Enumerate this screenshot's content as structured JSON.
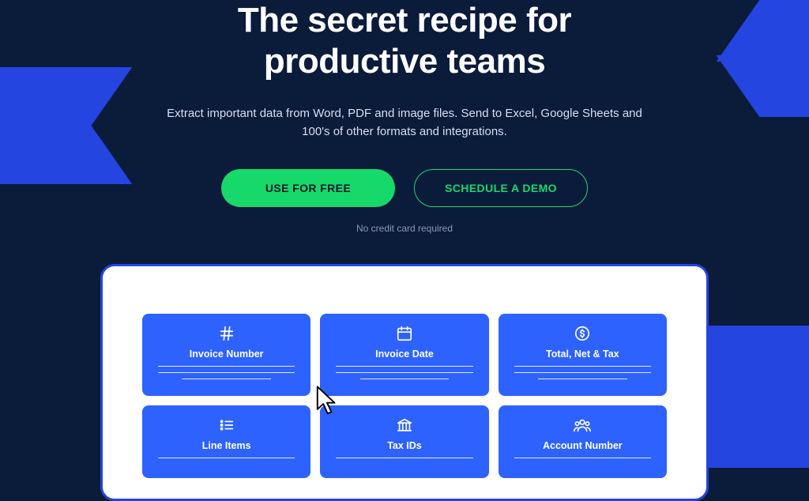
{
  "hero": {
    "headline_line1": "The secret recipe for",
    "headline_line2": "productive teams",
    "subhead": "Extract important data from Word, PDF and image files. Send to Excel, Google Sheets and 100's of other formats and integrations.",
    "cta_primary": "USE FOR FREE",
    "cta_secondary": "SCHEDULE A DEMO",
    "note": "No credit card required"
  },
  "cards": [
    {
      "label": "Invoice Number",
      "icon": "hash"
    },
    {
      "label": "Invoice Date",
      "icon": "calendar"
    },
    {
      "label": "Total, Net & Tax",
      "icon": "currency"
    },
    {
      "label": "Line Items",
      "icon": "list"
    },
    {
      "label": "Tax IDs",
      "icon": "bank"
    },
    {
      "label": "Account Number",
      "icon": "users"
    }
  ]
}
